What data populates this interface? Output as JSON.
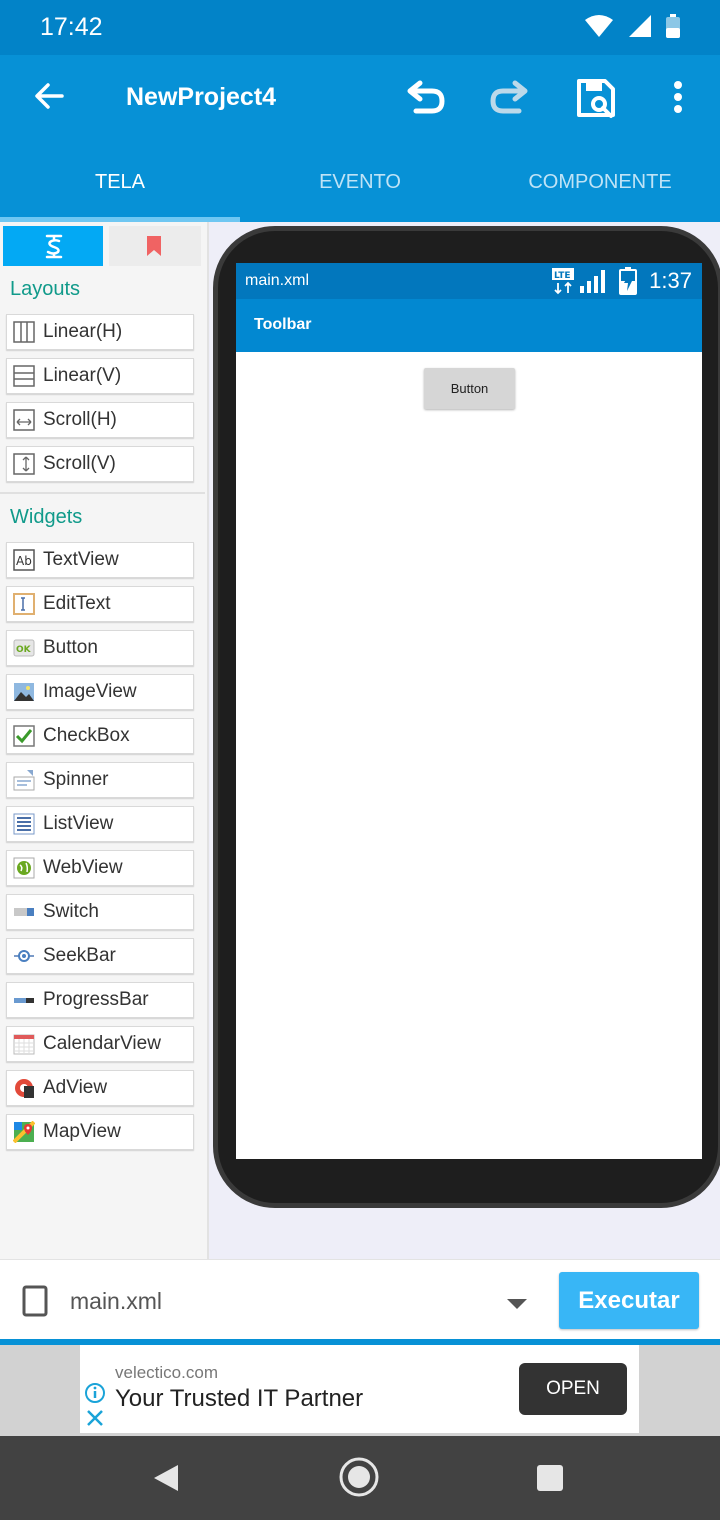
{
  "status_bar": {
    "time": "17:42",
    "battery_level": "33"
  },
  "app_bar": {
    "title": "NewProject4"
  },
  "tabs": [
    {
      "label": "TELA",
      "active": true
    },
    {
      "label": "EVENTO",
      "active": false
    },
    {
      "label": "COMPONENTE",
      "active": false
    }
  ],
  "palette": {
    "layouts_title": "Layouts",
    "layouts": [
      {
        "label": "Linear(H)",
        "icon": "linear-h-icon"
      },
      {
        "label": "Linear(V)",
        "icon": "linear-v-icon"
      },
      {
        "label": "Scroll(H)",
        "icon": "scroll-h-icon"
      },
      {
        "label": "Scroll(V)",
        "icon": "scroll-v-icon"
      }
    ],
    "widgets_title": "Widgets",
    "widgets": [
      {
        "label": "TextView",
        "icon": "textview-icon"
      },
      {
        "label": "EditText",
        "icon": "edittext-icon"
      },
      {
        "label": "Button",
        "icon": "button-icon"
      },
      {
        "label": "ImageView",
        "icon": "imageview-icon"
      },
      {
        "label": "CheckBox",
        "icon": "checkbox-icon"
      },
      {
        "label": "Spinner",
        "icon": "spinner-icon"
      },
      {
        "label": "ListView",
        "icon": "listview-icon"
      },
      {
        "label": "WebView",
        "icon": "webview-icon"
      },
      {
        "label": "Switch",
        "icon": "switch-icon"
      },
      {
        "label": "SeekBar",
        "icon": "seekbar-icon"
      },
      {
        "label": "ProgressBar",
        "icon": "progressbar-icon"
      },
      {
        "label": "CalendarView",
        "icon": "calendarview-icon"
      },
      {
        "label": "AdView",
        "icon": "adview-icon"
      },
      {
        "label": "MapView",
        "icon": "mapview-icon"
      }
    ]
  },
  "preview": {
    "status_file": "main.xml",
    "status_network": "LTE",
    "status_time": "1:37",
    "toolbar_label": "Toolbar",
    "button_label": "Button"
  },
  "bottom_bar": {
    "file": "main.xml",
    "run_label": "Executar"
  },
  "ad": {
    "domain": "velectico.com",
    "headline": "Your Trusted IT Partner",
    "cta": "OPEN"
  },
  "colors": {
    "primary": "#0791d6",
    "status": "#0283c8",
    "accent": "#38b6f6",
    "section_title": "#109a8a"
  }
}
